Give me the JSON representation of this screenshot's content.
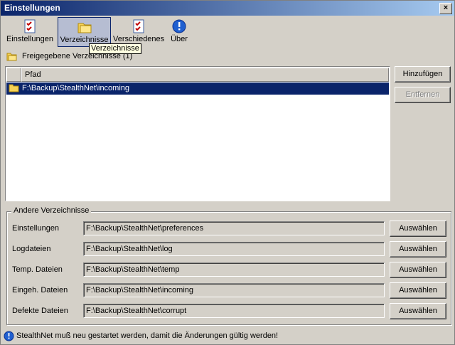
{
  "window": {
    "title": "Einstellungen",
    "close_glyph": "×"
  },
  "toolbar": {
    "items": [
      {
        "label": "Einstellungen",
        "icon": "checklist-icon"
      },
      {
        "label": "Verzeichnisse",
        "icon": "folder-icon",
        "active": true
      },
      {
        "label": "Verschiedenes",
        "icon": "checklist-icon"
      },
      {
        "label": "Über",
        "icon": "info-icon"
      }
    ],
    "tooltip": "Verzeichnisse"
  },
  "shared": {
    "heading": "Freigegebene Verzeichnisse (1)",
    "column_header": "Pfad",
    "rows": [
      "F:\\Backup\\StealthNet\\incoming"
    ],
    "add_label": "Hinzufügen",
    "remove_label": "Entfernen"
  },
  "other": {
    "legend": "Andere Verzeichnisse",
    "button_label": "Auswählen",
    "rows": [
      {
        "label": "Einstellungen",
        "path": "F:\\Backup\\StealthNet\\preferences"
      },
      {
        "label": "Logdateien",
        "path": "F:\\Backup\\StealthNet\\log"
      },
      {
        "label": "Temp. Dateien",
        "path": "F:\\Backup\\StealthNet\\temp"
      },
      {
        "label": "Eingeh. Dateien",
        "path": "F:\\Backup\\StealthNet\\incoming"
      },
      {
        "label": "Defekte Dateien",
        "path": "F:\\Backup\\StealthNet\\corrupt"
      }
    ]
  },
  "status": {
    "text": "StealthNet muß neu gestartet werden, damit die Änderungen gültig werden!"
  },
  "colors": {
    "titlebar_start": "#0a246a",
    "titlebar_end": "#a6caf0",
    "selection": "#0a246a",
    "face": "#d4d0c8"
  }
}
